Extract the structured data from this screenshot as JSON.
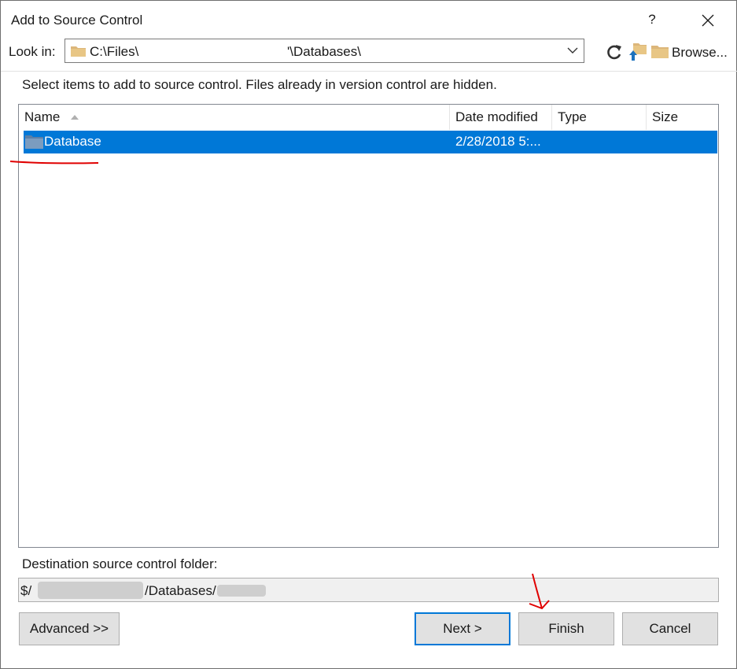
{
  "window": {
    "title": "Add to Source Control",
    "help_label": "?"
  },
  "lookin": {
    "label": "Look in:",
    "path_start": "C:\\Files\\",
    "path_end": "'\\Databases\\"
  },
  "toolbar": {
    "refresh_icon": "refresh-icon",
    "up_icon": "up-folder-icon",
    "browse_icon": "folder-icon",
    "browse_label": "Browse..."
  },
  "instructions": "Select items to add to source control. Files already in version control are hidden.",
  "list": {
    "columns": [
      {
        "label": "Name"
      },
      {
        "label": "Date modified"
      },
      {
        "label": "Type"
      },
      {
        "label": "Size"
      }
    ],
    "rows": [
      {
        "name": "Database",
        "date_modified": "2/28/2018 5:...",
        "type": "",
        "size": "",
        "selected": true
      }
    ]
  },
  "destination": {
    "label": "Destination source control folder:",
    "value_start": "$/",
    "value_end": "/Databases/"
  },
  "buttons": {
    "advanced": "Advanced >>",
    "next": "Next >",
    "finish": "Finish",
    "cancel": "Cancel"
  },
  "colors": {
    "selection": "#0078d7",
    "folder": "#dcb67a",
    "annotation": "#e00000"
  }
}
